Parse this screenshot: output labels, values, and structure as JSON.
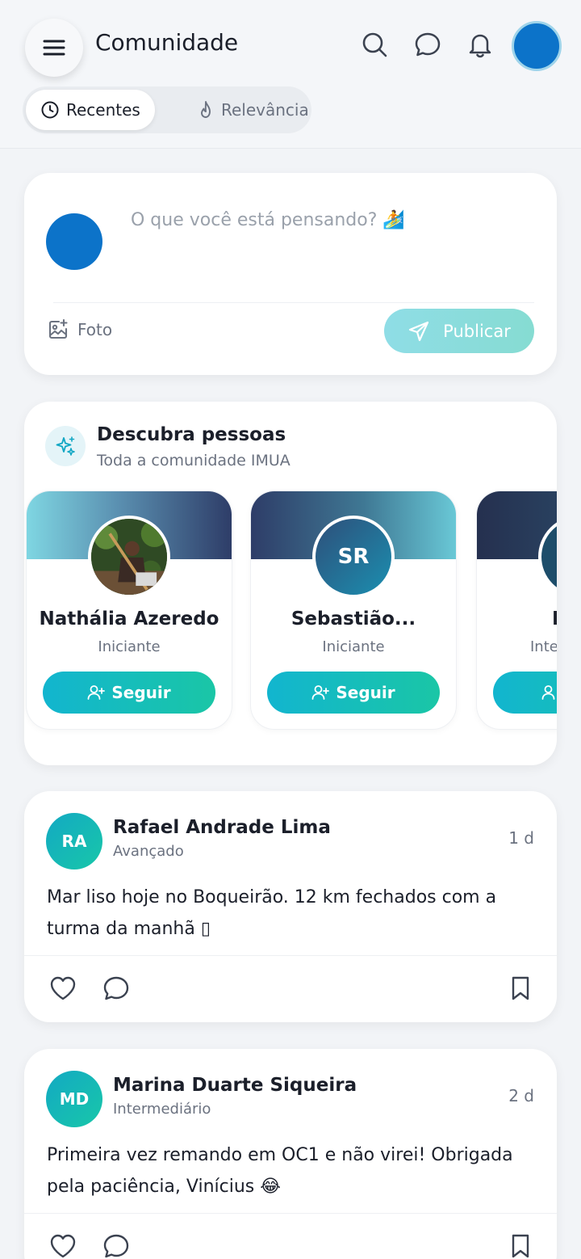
{
  "header": {
    "title": "Comunidade",
    "icons": [
      "menu-icon",
      "search-icon",
      "chat-icon",
      "bell-icon"
    ],
    "tabs": [
      {
        "label": "Recentes",
        "icon": "clock-icon",
        "active": true
      },
      {
        "label": "Relevância",
        "icon": "flame-icon",
        "active": false
      }
    ]
  },
  "composer": {
    "placeholder": "O que você está pensando? 🏄",
    "photo_label": "Foto",
    "publish_label": "Publicar"
  },
  "discover": {
    "title": "Descubra pessoas",
    "subtitle": "Toda a comunidade IMUA",
    "people": [
      {
        "name": "Nathália Azeredo",
        "level": "Iniciante",
        "initials": "",
        "follow_label": "Seguir"
      },
      {
        "name": "Sebastião...",
        "level": "Iniciante",
        "initials": "SR",
        "follow_label": "Seguir"
      },
      {
        "name": "E",
        "level": "Inte",
        "initials": "",
        "follow_label": ""
      }
    ]
  },
  "posts": [
    {
      "initials": "RA",
      "author": "Rafael Andrade Lima",
      "level": "Avançado",
      "time": "1 d",
      "text": "Mar liso hoje no Boqueirão. 12 km fechados com a turma da manhã ▯"
    },
    {
      "initials": "MD",
      "author": "Marina Duarte Siqueira",
      "level": "Intermediário",
      "time": "2 d",
      "text": "Primeira vez remando em OC1 e não virei! Obrigada pela paciência, Vinícius 😂"
    }
  ],
  "colors": {
    "accent": "#12b5cf",
    "accent2": "#1ac6a6",
    "avatar_blue": "#0c73c9",
    "banner_dark": "#2c3e66"
  }
}
